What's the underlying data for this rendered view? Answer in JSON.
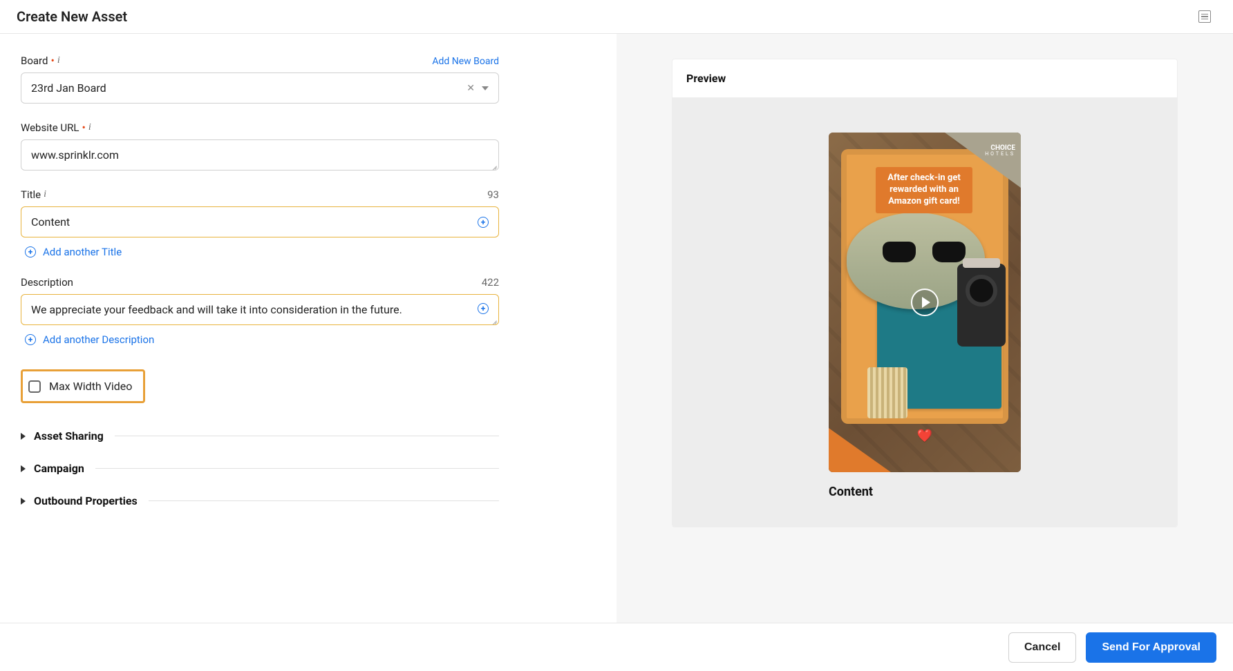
{
  "pageTitle": "Create New Asset",
  "form": {
    "board": {
      "label": "Board",
      "value": "23rd Jan Board",
      "addNewLink": "Add New Board"
    },
    "url": {
      "label": "Website URL",
      "value": "www.sprinklr.com"
    },
    "title": {
      "label": "Title",
      "value": "Content",
      "counter": "93",
      "addAnother": "Add another Title"
    },
    "description": {
      "label": "Description",
      "value": "We appreciate your feedback and will take it into consideration in the future.",
      "counter": "422",
      "addAnother": "Add another Description"
    },
    "maxWidthVideo": {
      "label": "Max Width Video",
      "checked": false
    },
    "accordions": [
      {
        "label": "Asset Sharing"
      },
      {
        "label": "Campaign"
      },
      {
        "label": "Outbound Properties"
      }
    ]
  },
  "preview": {
    "header": "Preview",
    "promo": "After check-in get rewarded with an Amazon gift card!",
    "brand": "CHOICE",
    "brandSub": "HOTELS",
    "heart": "❤️",
    "caption": "Content"
  },
  "footer": {
    "cancel": "Cancel",
    "sendForApproval": "Send For Approval"
  }
}
